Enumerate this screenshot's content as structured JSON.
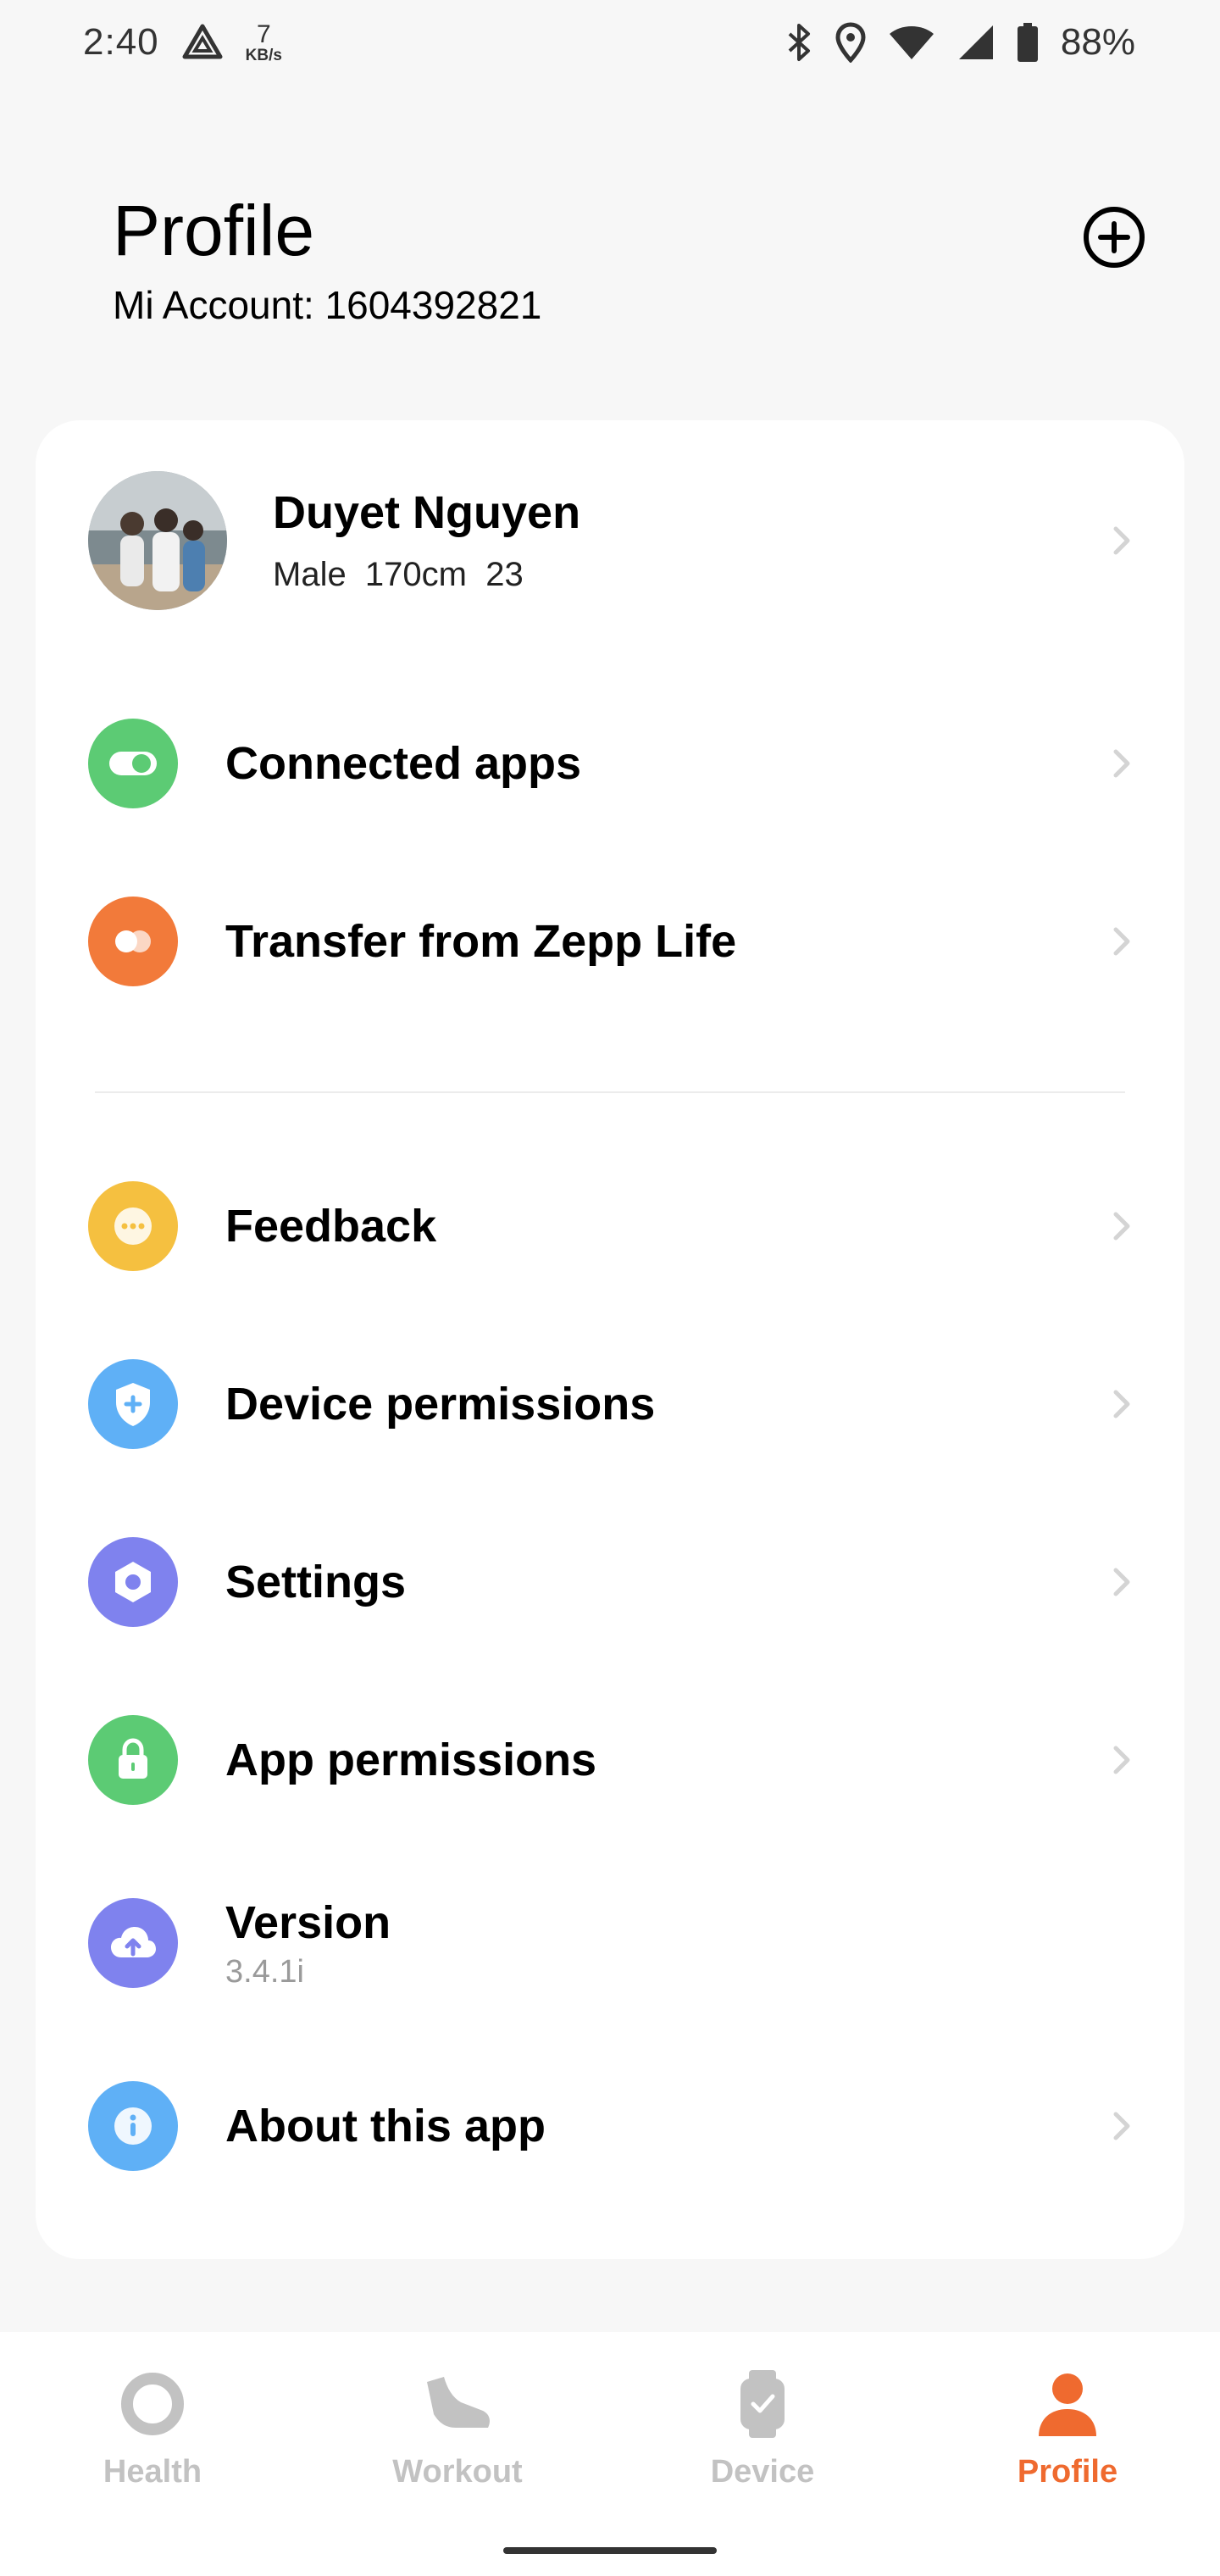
{
  "status_bar": {
    "time": "2:40",
    "speed_value": "7",
    "speed_unit": "KB/s",
    "battery": "88%"
  },
  "header": {
    "title": "Profile",
    "account": "Mi Account: 1604392821"
  },
  "user": {
    "name": "Duyet Nguyen",
    "meta": "Male  170cm  23"
  },
  "menu": {
    "connected_apps": "Connected apps",
    "transfer": "Transfer from Zepp Life",
    "feedback": "Feedback",
    "device_permissions": "Device permissions",
    "settings": "Settings",
    "app_permissions": "App permissions",
    "version": "Version",
    "version_value": "3.4.1i",
    "about": "About this app"
  },
  "nav": {
    "health": "Health",
    "workout": "Workout",
    "device": "Device",
    "profile": "Profile",
    "active": "profile"
  },
  "colors": {
    "accent": "#ef6a2f",
    "green": "#5ccb74",
    "orange": "#f27a3a",
    "yellow": "#f5c040",
    "blue": "#5fb0f6",
    "purple": "#7f82ee",
    "inactive": "#c2c2c2"
  },
  "icons": {
    "connected_apps": "toggle-icon",
    "transfer": "transfer-icon",
    "feedback": "chat-bubble-icon",
    "device_permissions": "shield-icon",
    "settings": "hexagon-gear-icon",
    "app_permissions": "lock-icon",
    "version": "cloud-upload-icon",
    "about": "info-icon"
  }
}
